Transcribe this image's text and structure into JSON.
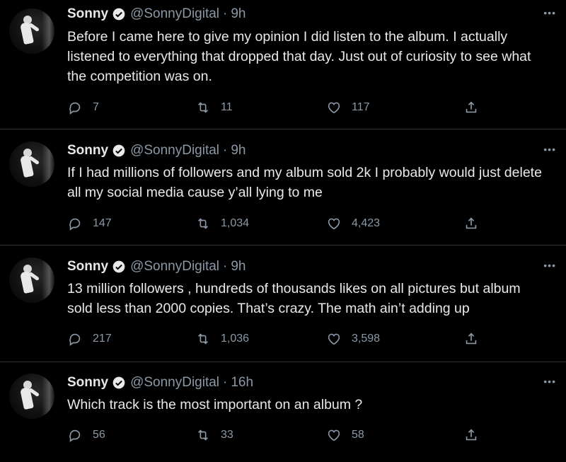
{
  "tweets": [
    {
      "name": "Sonny",
      "handle": "@SonnyDigital",
      "dot": "·",
      "time": "9h",
      "text": "Before I came here to give my opinion I did listen to the album. I actually listened to everything that dropped that day. Just out of curiosity to see what the competition was on.",
      "replies": "7",
      "retweets": "11",
      "likes": "117"
    },
    {
      "name": "Sonny",
      "handle": "@SonnyDigital",
      "dot": "·",
      "time": "9h",
      "text": "If I had millions of followers and my album sold 2k I probably would just delete all my social media cause y’all lying to me",
      "replies": "147",
      "retweets": "1,034",
      "likes": "4,423"
    },
    {
      "name": "Sonny",
      "handle": "@SonnyDigital",
      "dot": "·",
      "time": "9h",
      "text": "13 million followers , hundreds of thousands likes on all pictures but album sold less than 2000 copies. That’s crazy. The math ain’t adding up",
      "replies": "217",
      "retweets": "1,036",
      "likes": "3,598"
    },
    {
      "name": "Sonny",
      "handle": "@SonnyDigital",
      "dot": "·",
      "time": "16h",
      "text": "Which track is the most important on an album ?",
      "replies": "56",
      "retweets": "33",
      "likes": "58"
    }
  ],
  "more_label": "•••",
  "icons": {
    "reply": "reply-icon",
    "retweet": "retweet-icon",
    "like": "heart-icon",
    "share": "share-icon",
    "verified": "verified-badge-icon"
  },
  "colors": {
    "background": "#000000",
    "text": "#e7e9ea",
    "muted": "#8b98a5",
    "divider": "#2f3336"
  }
}
